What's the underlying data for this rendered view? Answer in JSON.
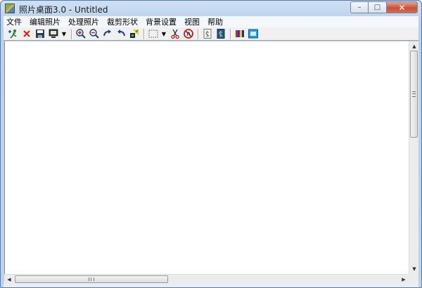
{
  "window": {
    "title": "照片桌面3.0 - Untitled",
    "controls": {
      "minimize": "–",
      "maximize": "□",
      "close": "✕"
    }
  },
  "menu": {
    "items": [
      "文件",
      "编辑照片",
      "处理照片",
      "裁剪形状",
      "背景设置",
      "视图",
      "帮助"
    ]
  },
  "toolbar": {
    "buttons": [
      {
        "name": "add-photo",
        "icon": "add-photo-icon"
      },
      {
        "name": "delete",
        "icon": "red-x-icon"
      },
      {
        "name": "save",
        "icon": "floppy-disk-icon"
      },
      {
        "name": "display",
        "icon": "monitor-icon",
        "dropdown": true
      },
      {
        "name": "zoom-in",
        "icon": "magnifier-plus-icon"
      },
      {
        "name": "zoom-out",
        "icon": "magnifier-minus-icon"
      },
      {
        "name": "rotate-right",
        "icon": "rotate-cw-icon"
      },
      {
        "name": "rotate-left",
        "icon": "rotate-ccw-icon"
      },
      {
        "name": "flip",
        "icon": "flip-icon"
      },
      {
        "name": "select",
        "icon": "dotted-rectangle-icon",
        "dropdown": true
      },
      {
        "name": "cut",
        "icon": "scissors-icon"
      },
      {
        "name": "no-crop",
        "icon": "no-symbol-icon"
      },
      {
        "name": "frame-1",
        "icon": "frame-icon"
      },
      {
        "name": "frame-2",
        "icon": "frame-color-icon"
      },
      {
        "name": "color-bars",
        "icon": "color-bars-icon"
      },
      {
        "name": "background",
        "icon": "background-icon"
      }
    ]
  },
  "colors": {
    "accent": "#2a7de1",
    "close_button": "#c7523a",
    "delete": "#e02020"
  }
}
